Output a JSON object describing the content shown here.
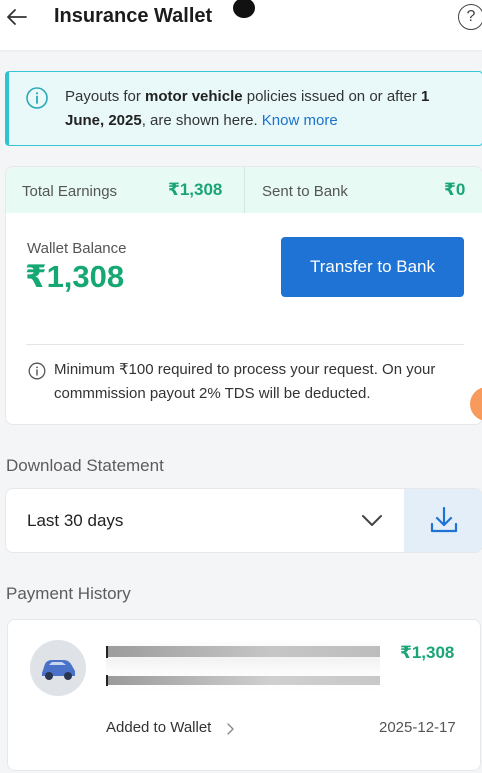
{
  "header": {
    "title": "Insurance Wallet",
    "help_label": "?"
  },
  "info_banner": {
    "text_before": "Payouts for ",
    "text_bold1": "motor vehicle",
    "text_middle": " policies issued on or after ",
    "text_bold2": "1 June, 2025",
    "text_after": ", are shown here. ",
    "link_text": "Know more"
  },
  "wallet": {
    "total_earnings_label": "Total Earnings",
    "total_earnings_value": "₹1,308",
    "sent_to_bank_label": "Sent to Bank",
    "sent_to_bank_value": "₹0",
    "balance_label": "Wallet Balance",
    "balance_value": "₹1,308",
    "transfer_button": "Transfer to Bank",
    "note": "Minimum ₹100 required to process your request. On your commmission payout 2% TDS will be deducted."
  },
  "download": {
    "section_title": "Download Statement",
    "selected_period": "Last 30 days"
  },
  "history": {
    "section_title": "Payment History",
    "items": [
      {
        "amount": "₹1,308",
        "status": "Added to Wallet",
        "date": "2025-12-17"
      }
    ]
  },
  "colors": {
    "accent_green": "#1aa576",
    "primary_blue": "#1e73d4",
    "banner_teal": "#2fc3cf"
  },
  "icons": [
    "back-arrow-icon",
    "help-icon",
    "info-icon",
    "chevron-down-icon",
    "download-icon",
    "car-icon",
    "chevron-right-icon"
  ]
}
